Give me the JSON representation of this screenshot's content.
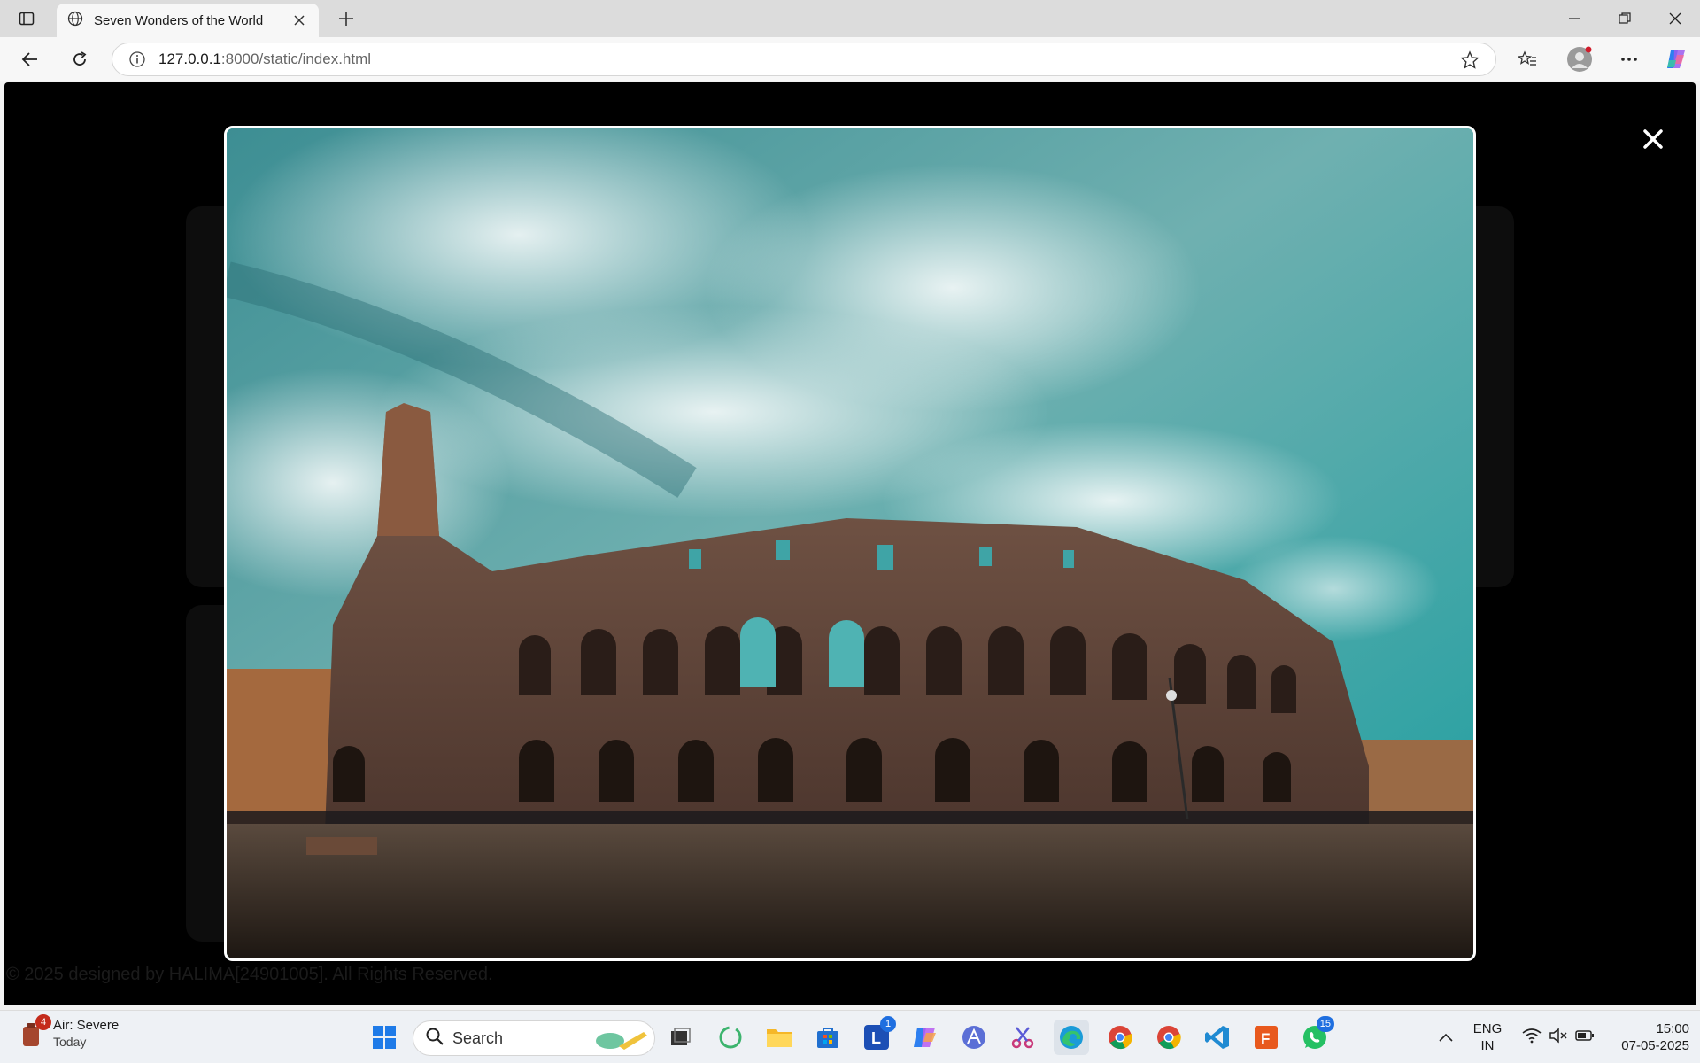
{
  "browser": {
    "tab_title": "Seven Wonders of the World",
    "url_host": "127.0.0.1",
    "url_rest": ":8000/static/index.html"
  },
  "page": {
    "footer": "© 2025 designed by HALIMA[24901005]. All Rights Reserved.",
    "lightbox": {
      "image_subject": "Colosseum",
      "close_label": "✕"
    }
  },
  "taskbar": {
    "weather_title": "Air: Severe",
    "weather_sub": "Today",
    "weather_badge": "4",
    "search_label": "Search",
    "lens_badge": "1",
    "whatsapp_badge": "15",
    "lang_top": "ENG",
    "lang_bottom": "IN",
    "time": "15:00",
    "date": "07-05-2025"
  }
}
